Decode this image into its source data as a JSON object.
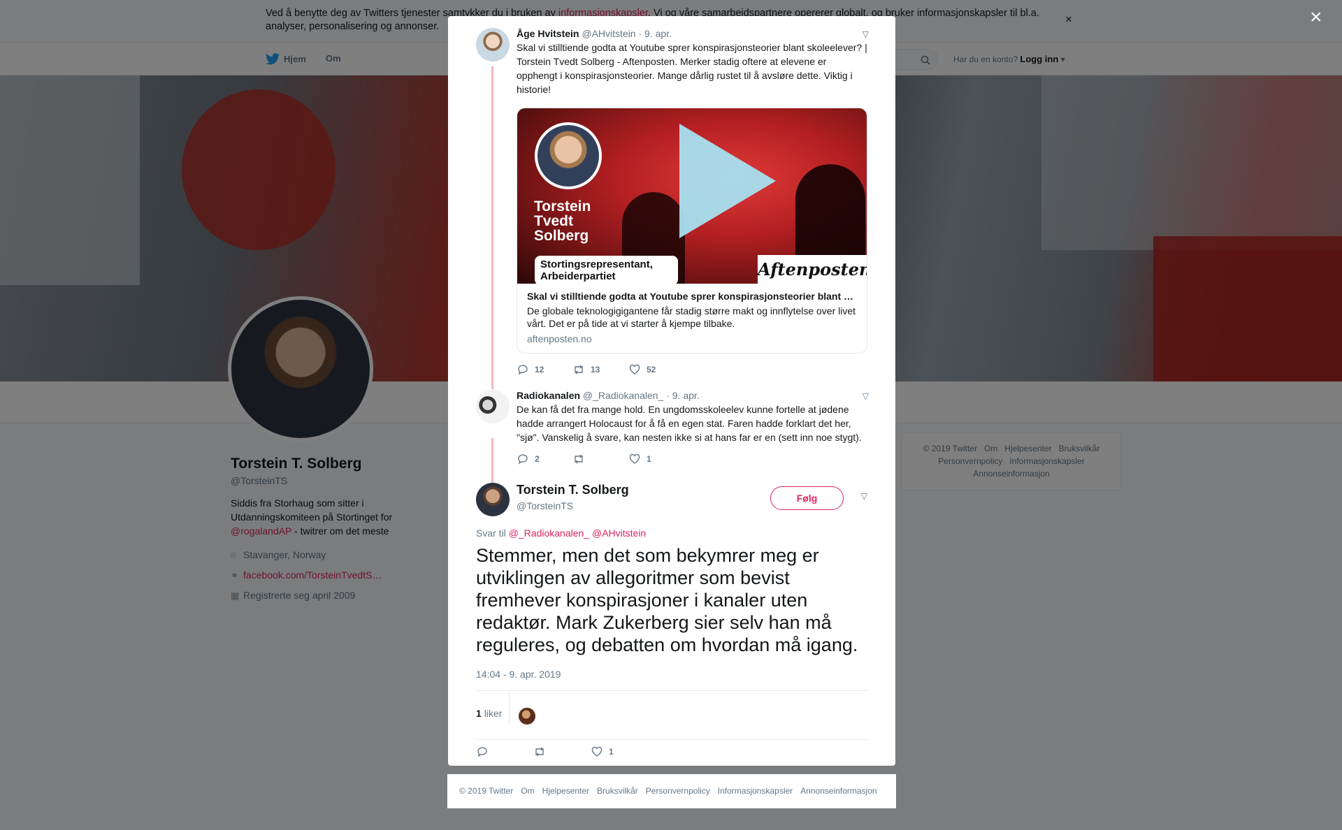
{
  "cookie": {
    "text_before": "Ved å benytte deg av Twitters tjenester samtykker du i bruken av ",
    "link": "informasjonskapsler",
    "text_after": ". Vi og våre samarbeidspartnere opererer globalt, og bruker informasjonskapsler til bl.a. analyser, personalisering og annonser.",
    "close": "×"
  },
  "nav": {
    "home": "Hjem",
    "about": "Om",
    "account_prompt": "Har du en konto?",
    "login": "Logg inn"
  },
  "profile": {
    "name": "Torstein T. Solberg",
    "handle": "@TorsteinTS",
    "bio_1": "Siddis fra Storhaug som sitter i Utdanningskomiteen på Stortinget for ",
    "bio_link": "@rogalandAP",
    "bio_2": " - twitrer om det meste",
    "location": "Stavanger, Norway",
    "url": "facebook.com/TorsteinTvedtS…",
    "joined": "Registrerte seg april 2009"
  },
  "side_footer": [
    "© 2019 Twitter",
    "Om",
    "Hjelpesenter",
    "Bruksvilkår",
    "Personvernpolicy",
    "Informasjonskapsler",
    "Annonseinformasjon"
  ],
  "modal": {
    "close": "×",
    "tweet1": {
      "name": "Åge Hvitstein",
      "handle": "@AHvitstein",
      "date": "· 9. apr.",
      "text": "Skal vi stilltiende godta at Youtube sprer konspirasjonsteorier blant skoleelever? | Torstein Tvedt Solberg - Aftenposten. Merker stadig oftere at elevene er opphengt i konspirasjonsteorier. Mange dårlig rustet til å avsløre dette. Viktig i historie!",
      "card": {
        "image_name": "Torstein Tvedt Solberg",
        "image_role": "Stortingsrepresentant, Arbeiderpartiet",
        "image_brand": "Aftenposten",
        "title": "Skal vi stilltiende godta at Youtube sprer konspirasjonsteorier blant …",
        "description": "De globale teknologigigantene får stadig større makt og innflytelse over livet vårt. Det er på tide at vi starter å kjempe tilbake.",
        "domain": "aftenposten.no"
      },
      "replies": "12",
      "retweets": "13",
      "likes": "52"
    },
    "tweet2": {
      "name": "Radiokanalen",
      "handle": "@_Radiokanalen_",
      "date": "· 9. apr.",
      "text": "De kan få det fra mange hold. En ungdomsskoleelev kunne fortelle at jødene hadde arrangert Holocaust for å få en egen stat. Faren hadde forklart det her, \"sjø\". Vanskelig å svare, kan nesten ikke si at hans far er en (sett inn noe stygt).",
      "replies": "2",
      "retweets": "",
      "likes": "1"
    },
    "main": {
      "name": "Torstein T. Solberg",
      "handle": "@TorsteinTS",
      "follow": "Følg",
      "reply_to": "Svar til",
      "reply_1": "@_Radiokanalen_",
      "reply_2": "@AHvitstein",
      "text": "Stemmer, men det som bekymrer meg er utviklingen av allegoritmer som bevist fremhever konspirasjoner i kanaler uten redaktør. Mark Zukerberg sier selv han må reguleres, og debatten om hvordan må igang.",
      "timestamp": "14:04 - 9. apr. 2019",
      "like_count": "1",
      "like_label": "liker",
      "likes": "1"
    }
  },
  "modal_footer": [
    "© 2019 Twitter",
    "Om",
    "Hjelpesenter",
    "Bruksvilkår",
    "Personvernpolicy",
    "Informasjonskapsler",
    "Annonseinformasjon"
  ],
  "colors": {
    "accent": "#e0245e",
    "muted": "#657786",
    "text": "#14171a",
    "thread": "#f4b4be"
  }
}
